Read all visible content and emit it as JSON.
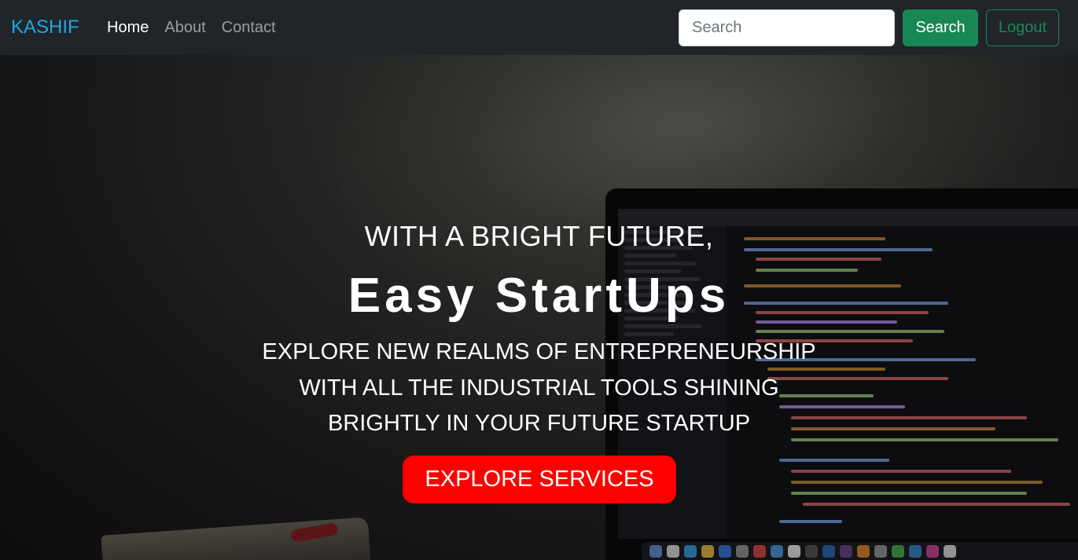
{
  "navbar": {
    "brand": "KASHIF",
    "links": [
      {
        "label": "Home"
      },
      {
        "label": "About"
      },
      {
        "label": "Contact"
      }
    ],
    "search": {
      "placeholder": "Search",
      "button_label": "Search"
    },
    "logout_label": "Logout"
  },
  "hero": {
    "pre_title": "WITH A BRIGHT FUTURE,",
    "title": "Easy StartUps",
    "subtitle_lines": [
      "EXPLORE NEW REALMS OF ENTREPRENEURSHIP",
      "WITH ALL THE INDUSTRIAL TOOLS SHINING",
      "BRIGHTLY IN YOUR FUTURE STARTUP"
    ],
    "cta_label": "EXPLORE SERVICES"
  },
  "colors": {
    "brand": "#1ea8e6",
    "navbar_bg": "#212529",
    "success": "#198754",
    "cta": "#ff0000"
  }
}
